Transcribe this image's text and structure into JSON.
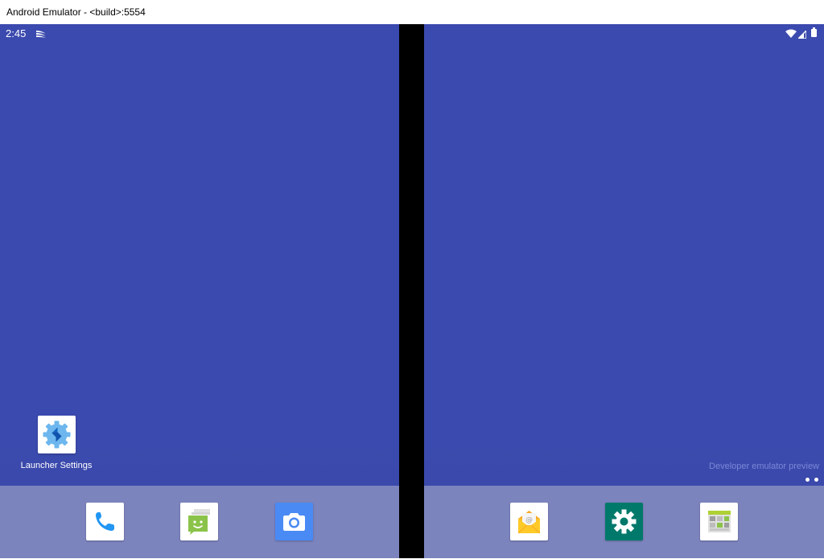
{
  "window": {
    "title": "Android Emulator - <build>:5554"
  },
  "status_bar": {
    "time": "2:45",
    "left_icons": [
      "swiftkey-icon"
    ],
    "right_icons": [
      "wifi-icon",
      "cellular-signal-icon",
      "battery-icon"
    ]
  },
  "left_screen": {
    "desktop_icons": [
      {
        "label": "Launcher Settings",
        "icon": "launcher-settings-icon"
      }
    ],
    "dock": [
      {
        "icon": "phone-icon",
        "app": "Phone"
      },
      {
        "icon": "messages-icon",
        "app": "Messages"
      },
      {
        "icon": "camera-icon",
        "app": "Camera"
      }
    ]
  },
  "right_screen": {
    "watermark": "Developer emulator preview",
    "page_indicator": {
      "pages": 2
    },
    "dock": [
      {
        "icon": "email-icon",
        "app": "Email"
      },
      {
        "icon": "settings-gear-icon",
        "app": "Settings"
      },
      {
        "icon": "gallery-icon",
        "app": "Gallery"
      }
    ]
  },
  "colors": {
    "wallpaper": "#3b4aae",
    "dock": "#7c84be",
    "hinge": "#000000",
    "accent_blue": "#2196f3",
    "settings_teal": "#00796b"
  }
}
